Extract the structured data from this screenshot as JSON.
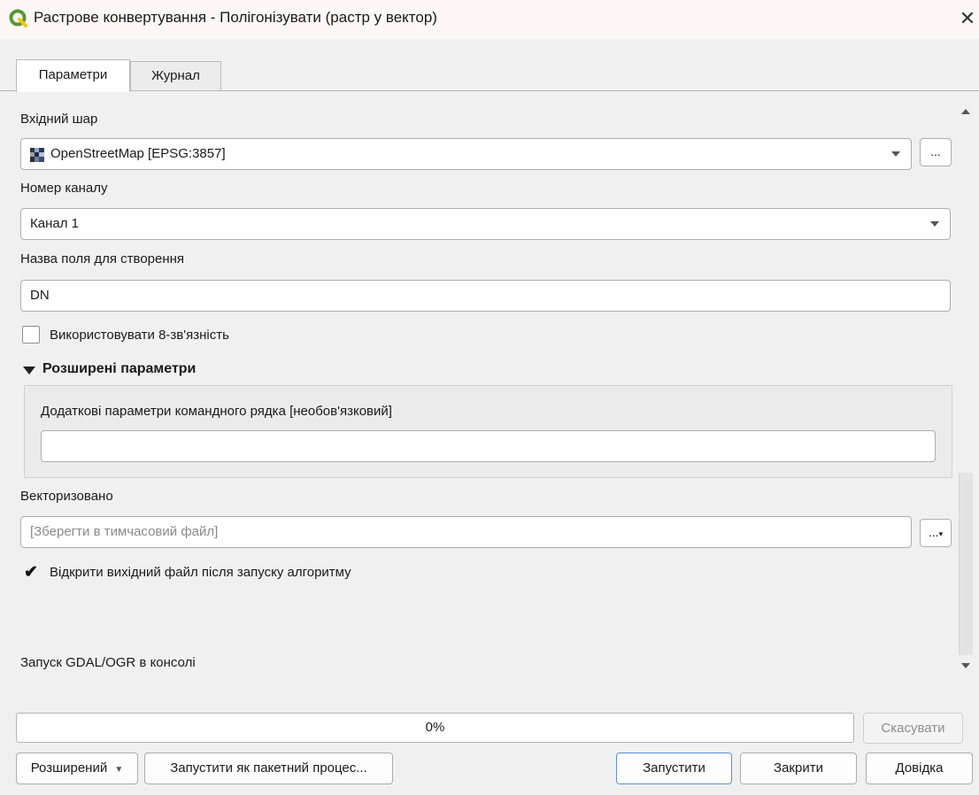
{
  "window": {
    "title": "Растрове конвертування - Полігонізувати (растр у вектор)",
    "close_symbol": "✕"
  },
  "tabs": [
    {
      "label": "Параметри",
      "active": true
    },
    {
      "label": "Журнал",
      "active": false
    }
  ],
  "params": {
    "input_layer_label": "Вхідний шар",
    "input_layer_value": "OpenStreetMap [EPSG:3857]",
    "input_layer_browse": "...",
    "band_label": "Номер каналу",
    "band_value": "Канал 1",
    "field_label": "Назва поля для створення",
    "field_value": "DN",
    "connectedness_label": "Використовувати 8-зв'язність",
    "connectedness_checked": false,
    "advanced_title": "Розширені параметри",
    "extra_label": "Додаткові параметри командного рядка [необов'язковий]",
    "extra_value": "",
    "output_label": "Векторизовано",
    "output_placeholder": "[Зберегти в тимчасовий файл]",
    "output_browse": "...",
    "open_output_label": "Відкрити вихідний файл після запуску алгоритму",
    "open_output_checked": true,
    "console_label": "Запуск GDAL/OGR в консолі"
  },
  "footer": {
    "progress_percent": 0,
    "progress_text": "0%",
    "cancel_label": "Скасувати",
    "advanced_label": "Розширений",
    "batch_label": "Запустити як пакетний процес...",
    "run_label": "Запустити",
    "close_label": "Закрити",
    "help_label": "Довідка"
  },
  "colors": {
    "accent": "#5b8fd4",
    "logo_green": "#589632",
    "logo_yellow": "#f0c419"
  }
}
